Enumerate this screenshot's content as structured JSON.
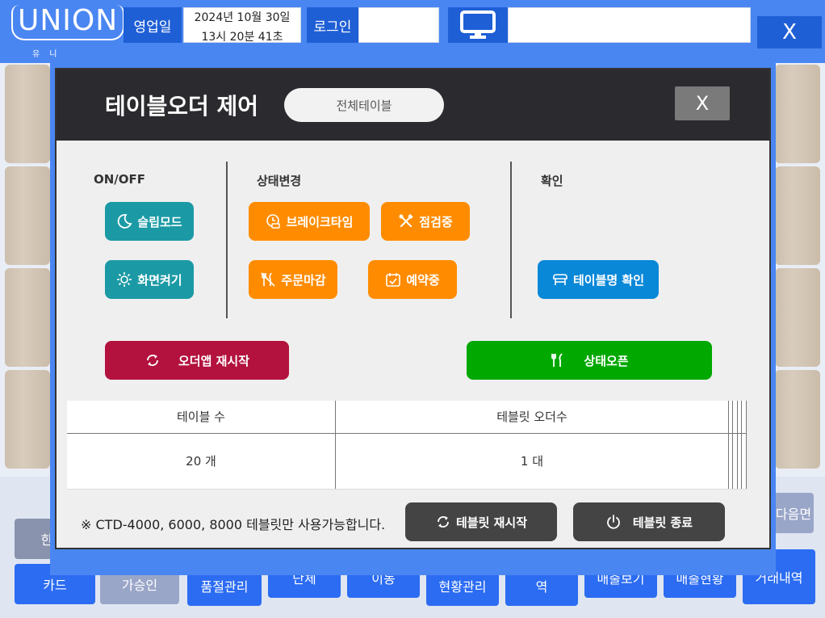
{
  "app": {
    "logo_text": "UNION",
    "logo_sub": "유니",
    "business_day_label": "영업일",
    "business_date": "2024년 10월 30일",
    "business_time": "13시 20분 41초",
    "login_label": "로그인",
    "close_label": "X"
  },
  "bottom_buttons": [
    "카드",
    "가승인",
    "품절관리",
    "단체",
    "이동",
    "현황관리",
    "역",
    "매출보기",
    "매출현황",
    "거래내역"
  ],
  "bottom_partial": {
    "left_label": "한",
    "next_page": "다음면"
  },
  "modal": {
    "title": "테이블오더 제어",
    "all_tables": "전체테이블",
    "close": "X",
    "sections": {
      "onoff": "ON/OFF",
      "status": "상태변경",
      "confirm": "확인"
    },
    "buttons": {
      "sleep": "슬립모드",
      "screen_on": "화면켜기",
      "break_time": "브레이크타임",
      "inspection": "점검중",
      "order_closed": "주문마감",
      "reserved": "예약중",
      "table_name_check": "테이블명 확인",
      "order_app_restart": "오더앱 재시작",
      "status_open": "상태오픈",
      "tablet_restart": "테블릿 재시작",
      "tablet_shutdown": "테블릿 종료"
    },
    "table": {
      "headers": [
        "테이블 수",
        "테블릿 오더수",
        "",
        "",
        "",
        ""
      ],
      "row": [
        "20 개",
        "1 대",
        "",
        "",
        "",
        ""
      ]
    },
    "note": "※ CTD-4000, 6000, 8000 테블릿만 사용가능합니다."
  },
  "colors": {
    "accent": "#4a86f2",
    "teal": "#1b9aa5",
    "orange": "#ff8c00",
    "blue": "#0a88d8",
    "red": "#b3123e",
    "green": "#00a800"
  }
}
